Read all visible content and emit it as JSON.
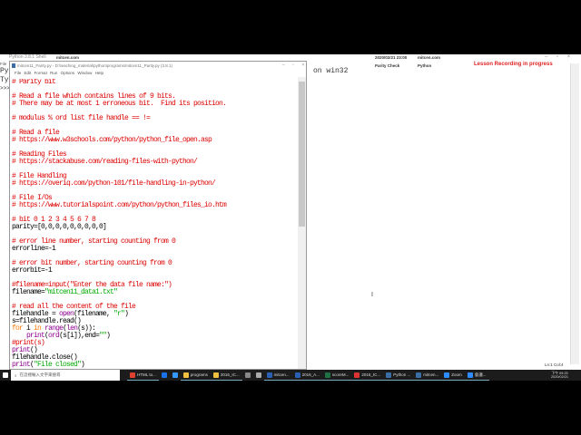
{
  "shell": {
    "title": "Python 3.8.1 Shell",
    "left_lines": [
      "Py",
      "Ty",
      ">>>"
    ],
    "file_menu": "File",
    "text": "on win32"
  },
  "overlay": {
    "site1": "mitcen.com",
    "datetime": "2020/02/21 23:00",
    "site2": "mitcen.com",
    "topic": "Parity Check",
    "lang": "Python",
    "recording": "Lesson Recording in progress"
  },
  "editor": {
    "title": "mitcen11_Parity.py - D:\\teaching_material\\python\\programs\\mitcen11_Parity.py (3.8.1)",
    "menu": [
      "File",
      "Edit",
      "Format",
      "Run",
      "Options",
      "Window",
      "Help"
    ],
    "colors": {
      "c": "#dd0000",
      "k": "#ff7700",
      "b": "#900090",
      "s": "#00aa00",
      "d": "#000000"
    },
    "lines": [
      [
        [
          "c",
          "# Parity bit"
        ]
      ],
      [],
      [
        [
          "c",
          "# Read a file which contains lines of 9 bits."
        ]
      ],
      [
        [
          "c",
          "# There may be at most 1 erroneous bit.  Find its position."
        ]
      ],
      [],
      [
        [
          "c",
          "# modulus % ord list file handle == !="
        ]
      ],
      [],
      [
        [
          "c",
          "# Read a file"
        ]
      ],
      [
        [
          "c",
          "# https://www.w3schools.com/python/python_file_open.asp"
        ]
      ],
      [],
      [
        [
          "c",
          "# Reading Files"
        ]
      ],
      [
        [
          "c",
          "# https://stackabuse.com/reading-files-with-python/"
        ]
      ],
      [],
      [
        [
          "c",
          "# File Handling"
        ]
      ],
      [
        [
          "c",
          "# https://overiq.com/python-101/file-handling-in-python/"
        ]
      ],
      [],
      [
        [
          "c",
          "# File I/Os"
        ]
      ],
      [
        [
          "c",
          "# https://www.tutorialspoint.com/python/python_files_io.htm"
        ]
      ],
      [],
      [
        [
          "c",
          "# bit 0 1 2 3 4 5 6 7 8"
        ]
      ],
      [
        [
          "d",
          "parity=[0,0,0,0,0,0,0,0,0]"
        ]
      ],
      [],
      [
        [
          "c",
          "# error line number, starting counting from 0"
        ]
      ],
      [
        [
          "d",
          "errorline=-1"
        ]
      ],
      [],
      [
        [
          "c",
          "# error bit number, starting counting from 0"
        ]
      ],
      [
        [
          "d",
          "errorbit=-1"
        ]
      ],
      [],
      [
        [
          "c",
          "#filename=input(\"Enter the data file name:\")"
        ]
      ],
      [
        [
          "d",
          "filename="
        ],
        [
          "s",
          "\"mitcen11_data1.txt\""
        ]
      ],
      [],
      [
        [
          "c",
          "# read all the content of the file"
        ]
      ],
      [
        [
          "d",
          "filehandle = "
        ],
        [
          "b",
          "open"
        ],
        [
          "d",
          "(filename, "
        ],
        [
          "s",
          "\"r\""
        ],
        [
          "d",
          ")"
        ]
      ],
      [
        [
          "d",
          "s=filehandle.read()"
        ]
      ],
      [
        [
          "k",
          "for"
        ],
        [
          "d",
          " i "
        ],
        [
          "k",
          "in"
        ],
        [
          "d",
          " "
        ],
        [
          "b",
          "range"
        ],
        [
          "d",
          "("
        ],
        [
          "b",
          "len"
        ],
        [
          "d",
          "(s)):"
        ]
      ],
      [
        [
          "d",
          "    "
        ],
        [
          "b",
          "print"
        ],
        [
          "d",
          "("
        ],
        [
          "b",
          "ord"
        ],
        [
          "d",
          "(s[i]),end="
        ],
        [
          "s",
          "\"\""
        ],
        [
          "d",
          ")"
        ]
      ],
      [
        [
          "c",
          "#print(s)"
        ]
      ],
      [
        [
          "b",
          "print"
        ],
        [
          "d",
          "()"
        ]
      ],
      [
        [
          "d",
          "filehandle.close()"
        ]
      ],
      [
        [
          "b",
          "print"
        ],
        [
          "d",
          "("
        ],
        [
          "s",
          "\"File closed\""
        ],
        [
          "d",
          ")"
        ]
      ]
    ]
  },
  "status": "Ln:1  Col:4",
  "taskbar": {
    "search": "在這裡輸入文字來搜尋",
    "items": [
      "HTML to...",
      "",
      "",
      "programs",
      "2016_IC...",
      "",
      "",
      "mitcen...",
      "2016_A...",
      "scoreM...",
      "2016_IC...",
      "Python ...",
      "mitcen...",
      "Zoom",
      "會議..."
    ],
    "time": "下午 09:25",
    "date": "2020/02/21"
  }
}
